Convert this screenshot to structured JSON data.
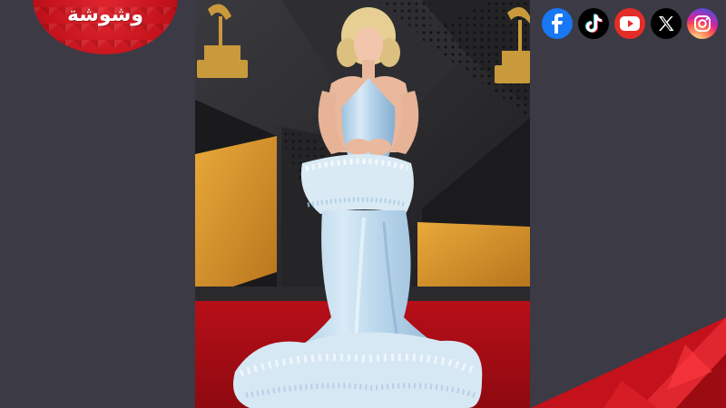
{
  "brand": {
    "logo_text": "وشوشة",
    "color": "#d61c24"
  },
  "photo": {
    "subject": "red-carpet-gown-photo"
  },
  "social": {
    "items": [
      {
        "name": "facebook",
        "color": "#1877f2"
      },
      {
        "name": "tiktok",
        "color": "#000000"
      },
      {
        "name": "youtube",
        "color": "#e52d27"
      },
      {
        "name": "x",
        "color": "#000000"
      },
      {
        "name": "instagram",
        "color": "#d6249f"
      }
    ]
  }
}
